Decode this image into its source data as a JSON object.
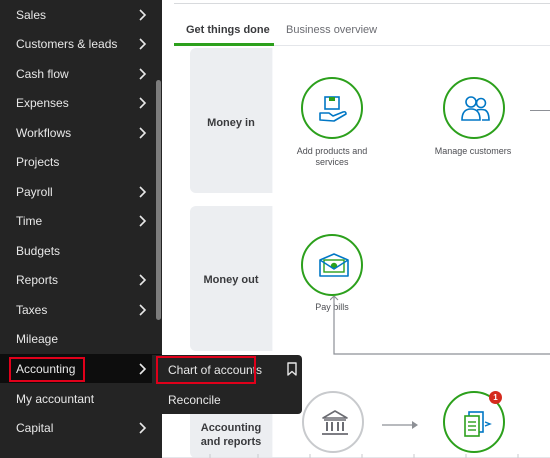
{
  "sidebar": {
    "items": [
      {
        "label": "Sales",
        "has_chevron": true
      },
      {
        "label": "Customers & leads",
        "has_chevron": true
      },
      {
        "label": "Cash flow",
        "has_chevron": true
      },
      {
        "label": "Expenses",
        "has_chevron": true
      },
      {
        "label": "Workflows",
        "has_chevron": true
      },
      {
        "label": "Projects",
        "has_chevron": false
      },
      {
        "label": "Payroll",
        "has_chevron": true
      },
      {
        "label": "Time",
        "has_chevron": true
      },
      {
        "label": "Budgets",
        "has_chevron": false
      },
      {
        "label": "Reports",
        "has_chevron": true
      },
      {
        "label": "Taxes",
        "has_chevron": true
      },
      {
        "label": "Mileage",
        "has_chevron": false
      },
      {
        "label": "Accounting",
        "has_chevron": true,
        "active": true
      },
      {
        "label": "My accountant",
        "has_chevron": false
      },
      {
        "label": "Capital",
        "has_chevron": true
      }
    ]
  },
  "flyout": {
    "items": [
      "Chart of accounts",
      "Reconcile"
    ],
    "bookmark_icon": "bookmark-icon"
  },
  "tabs": {
    "active": "Get things done",
    "inactive": "Business overview"
  },
  "sections": {
    "money_in": {
      "label": "Money in",
      "actions": [
        {
          "label": "Add products and services",
          "icon": "product-box-icon"
        },
        {
          "label": "Manage customers",
          "icon": "customers-icon"
        }
      ]
    },
    "money_out": {
      "label": "Money out",
      "actions": [
        {
          "label": "Pay bills",
          "icon": "pay-bills-icon"
        }
      ]
    },
    "accounting": {
      "label": "Accounting and reports",
      "actions": [
        {
          "label": "",
          "icon": "bank-icon"
        },
        {
          "label": "",
          "icon": "transactions-icon",
          "badge": "1"
        }
      ]
    }
  },
  "colors": {
    "sidebar_bg": "#242424",
    "accent_green": "#2ca01c",
    "highlight_red": "#e0001a",
    "badge_red": "#d52b1e"
  }
}
